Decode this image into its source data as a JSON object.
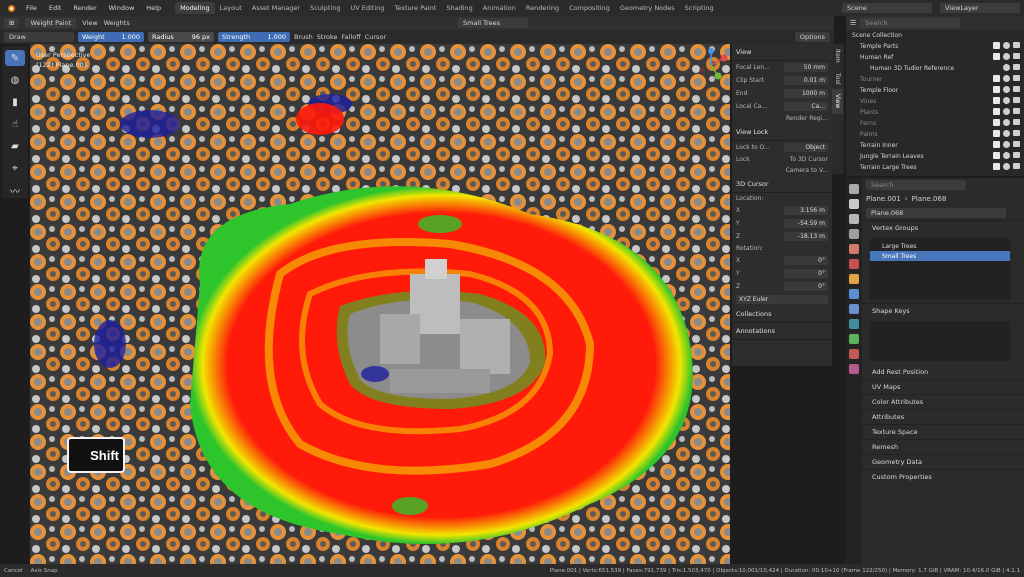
{
  "menubar": {
    "menus": [
      "File",
      "Edit",
      "Render",
      "Window",
      "Help"
    ],
    "workspaces": [
      "Modeling",
      "Layout",
      "Asset Manager",
      "Sculpting",
      "UV Editing",
      "Texture Paint",
      "Shading",
      "Animation",
      "Rendering",
      "Compositing",
      "Geometry Nodes",
      "Scripting"
    ],
    "active_workspace": "Modeling",
    "scene": "Scene",
    "view_layer": "ViewLayer"
  },
  "header": {
    "mode": "Weight Paint",
    "view": "View",
    "weights": "Weights",
    "active_group": "Small Trees",
    "options": "Options"
  },
  "toolbar_settings": {
    "brush_name": "Draw",
    "weight_label": "Weight",
    "weight_value": "1.000",
    "radius_label": "Radius",
    "radius_value": "96 px",
    "strength_label": "Strength",
    "strength_value": "1.000",
    "menus": [
      "Brush",
      "Stroke",
      "Falloff",
      "Cursor"
    ]
  },
  "viewport": {
    "perspective": "User Perspective",
    "object": "(122) Plane.001",
    "overlay_key": "Shift"
  },
  "npanel": {
    "tabs": [
      "Item",
      "Tool",
      "View"
    ],
    "active_tab": "View",
    "view_section": "View",
    "focal_label": "Focal Len...",
    "focal_value": "50 mm",
    "clip_start_label": "Clip Start",
    "clip_start_value": "0.01 m",
    "clip_end_label": "End",
    "clip_end_value": "1000 m",
    "local_camera_label": "Local Ca...",
    "local_camera_value": "Ca...",
    "render_region": "Render Regi...",
    "view_lock_section": "View Lock",
    "lock_to_object_label": "Lock to O...",
    "lock_to_object_value": "Object",
    "lock_label": "Lock",
    "lock_3d_cursor": "To 3D Cursor",
    "camera_to_view": "Camera to V...",
    "cursor_section": "3D Cursor",
    "location_label": "Location:",
    "loc_x_label": "X",
    "loc_x": "3.156 m",
    "loc_y_label": "Y",
    "loc_y": "-54.59 m",
    "loc_z_label": "Z",
    "loc_z": "-18.13 m",
    "rotation_label": "Rotation:",
    "rot_x_label": "X",
    "rot_x": "0°",
    "rot_y_label": "Y",
    "rot_y": "0°",
    "rot_z_label": "Z",
    "rot_z": "0°",
    "rotation_mode": "XYZ Euler",
    "collections": "Collections",
    "annotations": "Annotations"
  },
  "outliner": {
    "search_placeholder": "Search",
    "rows": [
      {
        "label": "Scene Collection",
        "dim": false
      },
      {
        "label": "Temple Parts",
        "dim": false
      },
      {
        "label": "Human Ref",
        "dim": false
      },
      {
        "label": "Human 3D Tudior Reference",
        "dim": false
      },
      {
        "label": "Tourner",
        "dim": true
      },
      {
        "label": "Temple Floor",
        "dim": false
      },
      {
        "label": "Vines",
        "dim": true
      },
      {
        "label": "Plants",
        "dim": true
      },
      {
        "label": "Ferns",
        "dim": true
      },
      {
        "label": "Palms",
        "dim": true
      },
      {
        "label": "Terrain Inner",
        "dim": false
      },
      {
        "label": "Jungle Terrain Leaves",
        "dim": false
      },
      {
        "label": "Terrain Large Trees",
        "dim": false
      }
    ]
  },
  "properties": {
    "search_placeholder": "Search",
    "object_name": "Plane.001",
    "data_name": "Plane.068",
    "mesh_name": "Plane.068",
    "vertex_groups_label": "Vertex Groups",
    "vertex_groups": [
      "Large Trees",
      "Small Trees"
    ],
    "selected_group": "Small Trees",
    "shape_keys_label": "Shape Keys",
    "add_rest_position": "Add Rest Position",
    "sections": [
      "UV Maps",
      "Color Attributes",
      "Attributes",
      "Texture Space",
      "Remesh",
      "Geometry Data",
      "Custom Properties"
    ]
  },
  "status_bar": {
    "left": [
      "Cancel",
      "Axis Snap"
    ],
    "stats": "Plane.001 | Verts:651,539 | Faces:791,739 | Tris:1,503,470 | Objects:10,001/10,424 | Duration: 00:10+10 (Frame 122/250) | Memory: 1.7 GiB | VRAM: 10.4/16.0 GiB | 4.1.1"
  },
  "colors": {
    "accent": "#4a74b8",
    "heat_red": "#ff1a0a",
    "heat_yellow": "#f2e600",
    "heat_green": "#2ec42b",
    "heat_blue": "#1d1f9e",
    "foliage_orange": "#e6923a"
  }
}
